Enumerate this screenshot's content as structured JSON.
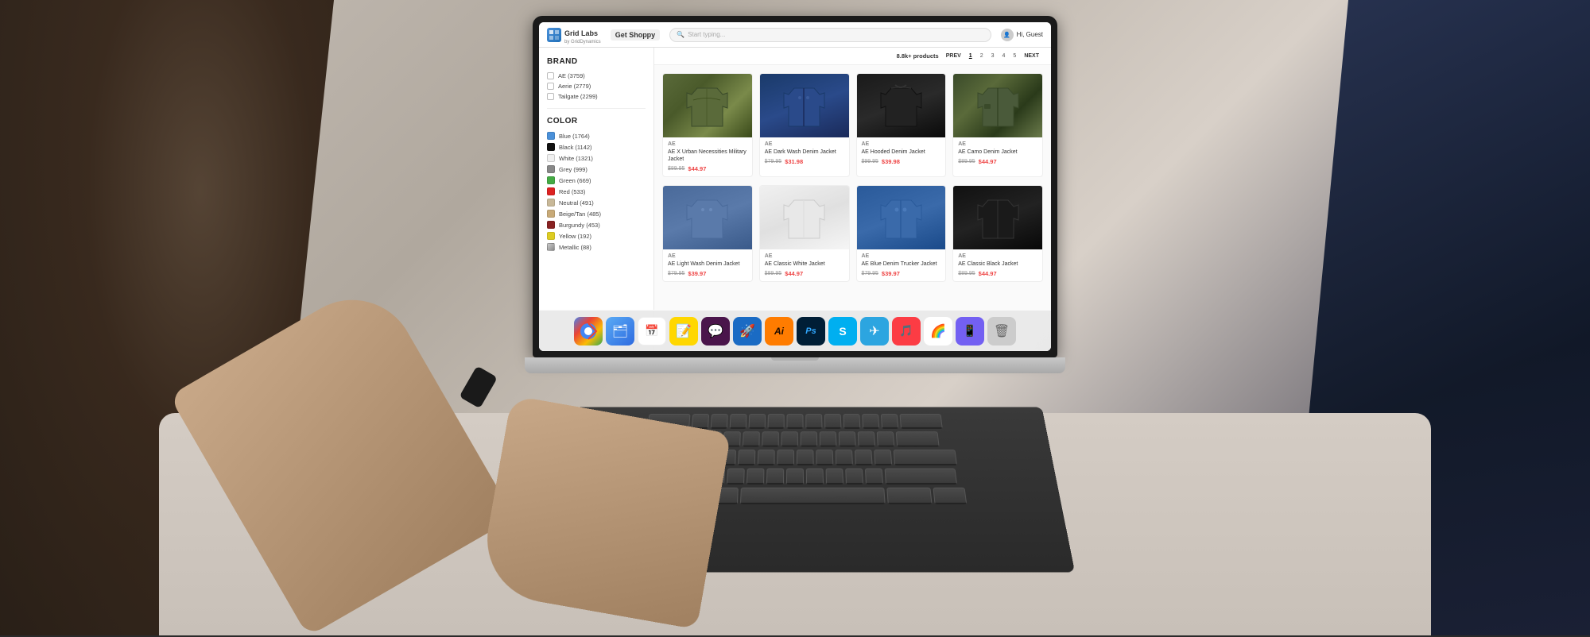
{
  "app": {
    "title": "Grid Labs",
    "subtitle": "by GridDynamics",
    "nav_item": "Get Shoppy",
    "search_placeholder": "Start typing...",
    "user_greeting": "Hi, Guest"
  },
  "filters": {
    "brand_title": "BRAND",
    "color_title": "COLOR",
    "brands": [
      {
        "label": "AE (3759)",
        "checked": false
      },
      {
        "label": "Aerie (2779)",
        "checked": false
      },
      {
        "label": "Tailgate (2299)",
        "checked": false
      }
    ],
    "colors": [
      {
        "name": "Blue",
        "count": "1764",
        "hex": "#4a90d9"
      },
      {
        "name": "Black",
        "count": "1142",
        "hex": "#111111"
      },
      {
        "name": "White",
        "count": "1321",
        "hex": "#f5f5f5"
      },
      {
        "name": "Grey",
        "count": "999",
        "hex": "#888888"
      },
      {
        "name": "Green",
        "count": "669",
        "hex": "#44aa44"
      },
      {
        "name": "Red",
        "count": "533",
        "hex": "#dd2222"
      },
      {
        "name": "Neutral",
        "count": "491",
        "hex": "#c8b898"
      },
      {
        "name": "Beige/Tan",
        "count": "485",
        "hex": "#c8aa78"
      },
      {
        "name": "Burgundy",
        "count": "453",
        "hex": "#882222"
      },
      {
        "name": "Yellow",
        "count": "192",
        "hex": "#ddcc22"
      },
      {
        "name": "Metallic",
        "count": "88",
        "hex": "#aaaaaa"
      }
    ]
  },
  "products_header": {
    "count": "8.8k+ products",
    "prev_label": "PREV",
    "next_label": "NEXT",
    "pages": [
      "1",
      "2",
      "3",
      "4",
      "5"
    ],
    "current_page": "1"
  },
  "products": [
    {
      "brand": "AE",
      "name": "AE X Urban Necessities Military Jacket",
      "original_price": "$89.95",
      "sale_price": "$44.97",
      "color": "#5a6a3a"
    },
    {
      "brand": "AE",
      "name": "AE Dark Wash Denim Jacket",
      "original_price": "$79.95",
      "sale_price": "$31.98",
      "color": "#1a3a6a"
    },
    {
      "brand": "AE",
      "name": "AE Hooded Denim Jacket",
      "original_price": "$99.95",
      "sale_price": "$39.98",
      "color": "#1a1a1a"
    },
    {
      "brand": "AE",
      "name": "AE Camo Denim Jacket",
      "original_price": "$89.95",
      "sale_price": "$44.97",
      "color": "#3a4a2a"
    },
    {
      "brand": "AE",
      "name": "AE Light Wash Denim Jacket",
      "original_price": "$79.95",
      "sale_price": "$39.97",
      "color": "#4a6a9a"
    },
    {
      "brand": "AE",
      "name": "AE Classic White Jacket",
      "original_price": "$89.95",
      "sale_price": "$44.97",
      "color": "#e8e8e8"
    },
    {
      "brand": "AE",
      "name": "AE Blue Denim Trucker Jacket",
      "original_price": "$79.95",
      "sale_price": "$39.97",
      "color": "#2a5a9a"
    },
    {
      "brand": "AE",
      "name": "AE Classic Black Jacket",
      "original_price": "$89.95",
      "sale_price": "$44.97",
      "color": "#111111"
    }
  ],
  "dock": {
    "apps": [
      {
        "name": "Chrome",
        "icon": "🟡",
        "label": "Google Chrome"
      },
      {
        "name": "Finder",
        "icon": "🗂",
        "label": "Finder"
      },
      {
        "name": "Calendar",
        "icon": "📅",
        "label": "Calendar"
      },
      {
        "name": "Notes",
        "icon": "📝",
        "label": "Notes"
      },
      {
        "name": "Slack",
        "icon": "💬",
        "label": "Slack"
      },
      {
        "name": "Transmit",
        "icon": "🚀",
        "label": "Transmit"
      },
      {
        "name": "Illustrator",
        "icon": "Ai",
        "label": "Adobe Illustrator"
      },
      {
        "name": "Photoshop",
        "icon": "Ps",
        "label": "Adobe Photoshop"
      },
      {
        "name": "Skype",
        "icon": "S",
        "label": "Skype"
      },
      {
        "name": "Telegram",
        "icon": "✈",
        "label": "Telegram"
      },
      {
        "name": "Music",
        "icon": "🎵",
        "label": "Music"
      },
      {
        "name": "Photos",
        "icon": "🖼",
        "label": "Photos"
      },
      {
        "name": "Viber",
        "icon": "📱",
        "label": "Viber"
      },
      {
        "name": "Trash",
        "icon": "🗑",
        "label": "Trash"
      }
    ]
  }
}
